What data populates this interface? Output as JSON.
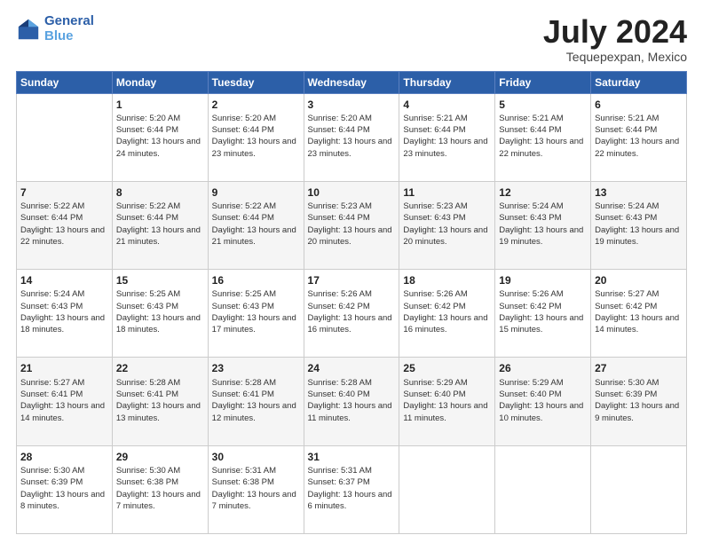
{
  "logo": {
    "line1": "General",
    "line2": "Blue"
  },
  "title": "July 2024",
  "subtitle": "Tequepexpan, Mexico",
  "headers": [
    "Sunday",
    "Monday",
    "Tuesday",
    "Wednesday",
    "Thursday",
    "Friday",
    "Saturday"
  ],
  "weeks": [
    [
      {
        "day": "",
        "sunrise": "",
        "sunset": "",
        "daylight": ""
      },
      {
        "day": "1",
        "sunrise": "Sunrise: 5:20 AM",
        "sunset": "Sunset: 6:44 PM",
        "daylight": "Daylight: 13 hours and 24 minutes."
      },
      {
        "day": "2",
        "sunrise": "Sunrise: 5:20 AM",
        "sunset": "Sunset: 6:44 PM",
        "daylight": "Daylight: 13 hours and 23 minutes."
      },
      {
        "day": "3",
        "sunrise": "Sunrise: 5:20 AM",
        "sunset": "Sunset: 6:44 PM",
        "daylight": "Daylight: 13 hours and 23 minutes."
      },
      {
        "day": "4",
        "sunrise": "Sunrise: 5:21 AM",
        "sunset": "Sunset: 6:44 PM",
        "daylight": "Daylight: 13 hours and 23 minutes."
      },
      {
        "day": "5",
        "sunrise": "Sunrise: 5:21 AM",
        "sunset": "Sunset: 6:44 PM",
        "daylight": "Daylight: 13 hours and 22 minutes."
      },
      {
        "day": "6",
        "sunrise": "Sunrise: 5:21 AM",
        "sunset": "Sunset: 6:44 PM",
        "daylight": "Daylight: 13 hours and 22 minutes."
      }
    ],
    [
      {
        "day": "7",
        "sunrise": "Sunrise: 5:22 AM",
        "sunset": "Sunset: 6:44 PM",
        "daylight": "Daylight: 13 hours and 22 minutes."
      },
      {
        "day": "8",
        "sunrise": "Sunrise: 5:22 AM",
        "sunset": "Sunset: 6:44 PM",
        "daylight": "Daylight: 13 hours and 21 minutes."
      },
      {
        "day": "9",
        "sunrise": "Sunrise: 5:22 AM",
        "sunset": "Sunset: 6:44 PM",
        "daylight": "Daylight: 13 hours and 21 minutes."
      },
      {
        "day": "10",
        "sunrise": "Sunrise: 5:23 AM",
        "sunset": "Sunset: 6:44 PM",
        "daylight": "Daylight: 13 hours and 20 minutes."
      },
      {
        "day": "11",
        "sunrise": "Sunrise: 5:23 AM",
        "sunset": "Sunset: 6:43 PM",
        "daylight": "Daylight: 13 hours and 20 minutes."
      },
      {
        "day": "12",
        "sunrise": "Sunrise: 5:24 AM",
        "sunset": "Sunset: 6:43 PM",
        "daylight": "Daylight: 13 hours and 19 minutes."
      },
      {
        "day": "13",
        "sunrise": "Sunrise: 5:24 AM",
        "sunset": "Sunset: 6:43 PM",
        "daylight": "Daylight: 13 hours and 19 minutes."
      }
    ],
    [
      {
        "day": "14",
        "sunrise": "Sunrise: 5:24 AM",
        "sunset": "Sunset: 6:43 PM",
        "daylight": "Daylight: 13 hours and 18 minutes."
      },
      {
        "day": "15",
        "sunrise": "Sunrise: 5:25 AM",
        "sunset": "Sunset: 6:43 PM",
        "daylight": "Daylight: 13 hours and 18 minutes."
      },
      {
        "day": "16",
        "sunrise": "Sunrise: 5:25 AM",
        "sunset": "Sunset: 6:43 PM",
        "daylight": "Daylight: 13 hours and 17 minutes."
      },
      {
        "day": "17",
        "sunrise": "Sunrise: 5:26 AM",
        "sunset": "Sunset: 6:42 PM",
        "daylight": "Daylight: 13 hours and 16 minutes."
      },
      {
        "day": "18",
        "sunrise": "Sunrise: 5:26 AM",
        "sunset": "Sunset: 6:42 PM",
        "daylight": "Daylight: 13 hours and 16 minutes."
      },
      {
        "day": "19",
        "sunrise": "Sunrise: 5:26 AM",
        "sunset": "Sunset: 6:42 PM",
        "daylight": "Daylight: 13 hours and 15 minutes."
      },
      {
        "day": "20",
        "sunrise": "Sunrise: 5:27 AM",
        "sunset": "Sunset: 6:42 PM",
        "daylight": "Daylight: 13 hours and 14 minutes."
      }
    ],
    [
      {
        "day": "21",
        "sunrise": "Sunrise: 5:27 AM",
        "sunset": "Sunset: 6:41 PM",
        "daylight": "Daylight: 13 hours and 14 minutes."
      },
      {
        "day": "22",
        "sunrise": "Sunrise: 5:28 AM",
        "sunset": "Sunset: 6:41 PM",
        "daylight": "Daylight: 13 hours and 13 minutes."
      },
      {
        "day": "23",
        "sunrise": "Sunrise: 5:28 AM",
        "sunset": "Sunset: 6:41 PM",
        "daylight": "Daylight: 13 hours and 12 minutes."
      },
      {
        "day": "24",
        "sunrise": "Sunrise: 5:28 AM",
        "sunset": "Sunset: 6:40 PM",
        "daylight": "Daylight: 13 hours and 11 minutes."
      },
      {
        "day": "25",
        "sunrise": "Sunrise: 5:29 AM",
        "sunset": "Sunset: 6:40 PM",
        "daylight": "Daylight: 13 hours and 11 minutes."
      },
      {
        "day": "26",
        "sunrise": "Sunrise: 5:29 AM",
        "sunset": "Sunset: 6:40 PM",
        "daylight": "Daylight: 13 hours and 10 minutes."
      },
      {
        "day": "27",
        "sunrise": "Sunrise: 5:30 AM",
        "sunset": "Sunset: 6:39 PM",
        "daylight": "Daylight: 13 hours and 9 minutes."
      }
    ],
    [
      {
        "day": "28",
        "sunrise": "Sunrise: 5:30 AM",
        "sunset": "Sunset: 6:39 PM",
        "daylight": "Daylight: 13 hours and 8 minutes."
      },
      {
        "day": "29",
        "sunrise": "Sunrise: 5:30 AM",
        "sunset": "Sunset: 6:38 PM",
        "daylight": "Daylight: 13 hours and 7 minutes."
      },
      {
        "day": "30",
        "sunrise": "Sunrise: 5:31 AM",
        "sunset": "Sunset: 6:38 PM",
        "daylight": "Daylight: 13 hours and 7 minutes."
      },
      {
        "day": "31",
        "sunrise": "Sunrise: 5:31 AM",
        "sunset": "Sunset: 6:37 PM",
        "daylight": "Daylight: 13 hours and 6 minutes."
      },
      {
        "day": "",
        "sunrise": "",
        "sunset": "",
        "daylight": ""
      },
      {
        "day": "",
        "sunrise": "",
        "sunset": "",
        "daylight": ""
      },
      {
        "day": "",
        "sunrise": "",
        "sunset": "",
        "daylight": ""
      }
    ]
  ]
}
